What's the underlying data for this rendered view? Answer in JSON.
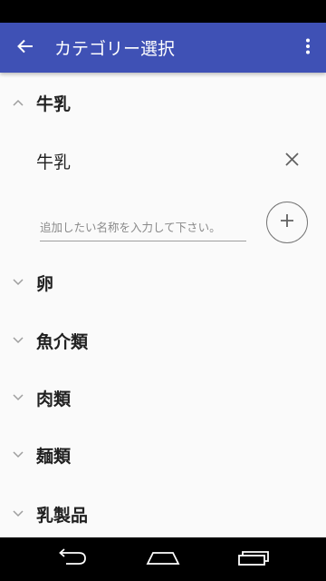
{
  "app_bar": {
    "title": "カテゴリー選択",
    "back_icon": "arrow-left-icon",
    "menu_icon": "more-vertical-icon",
    "color": "#3f51b5"
  },
  "categories": [
    {
      "label": "牛乳",
      "expanded": true,
      "items": [
        {
          "label": "牛乳"
        }
      ],
      "add_input": {
        "placeholder": "追加したい名称を入力して下さい。",
        "value": ""
      }
    },
    {
      "label": "卵",
      "expanded": false
    },
    {
      "label": "魚介類",
      "expanded": false
    },
    {
      "label": "肉類",
      "expanded": false
    },
    {
      "label": "麺類",
      "expanded": false
    },
    {
      "label": "乳製品",
      "expanded": false
    }
  ],
  "nav_bar": {
    "back_icon": "nav-back-icon",
    "home_icon": "nav-home-icon",
    "recents_icon": "nav-recents-icon"
  }
}
